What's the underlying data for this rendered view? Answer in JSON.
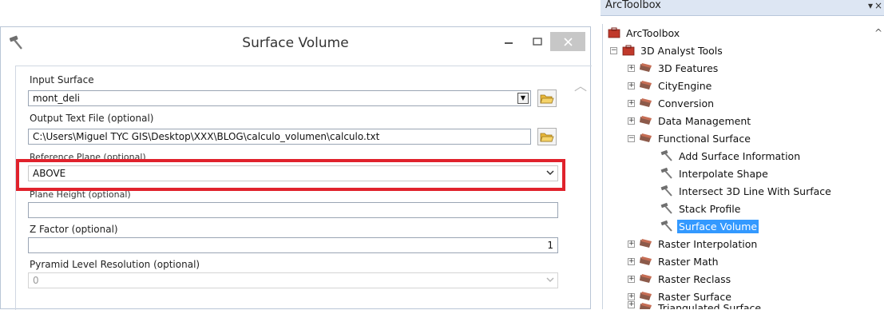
{
  "dialog": {
    "title": "Surface Volume",
    "fields": {
      "input_surface": {
        "label": "Input Surface",
        "value": "mont_deli"
      },
      "output_text": {
        "label": "Output Text File (optional)",
        "value": "C:\\Users\\Miguel TYC GIS\\Desktop\\XXX\\BLOG\\calculo_volumen\\calculo.txt"
      },
      "reference_plane": {
        "label": "Reference Plane (optional)",
        "value": "ABOVE"
      },
      "plane_height": {
        "label": "Plane Height (optional)",
        "value": ""
      },
      "z_factor": {
        "label": "Z Factor (optional)",
        "value": "1"
      },
      "pyramid_level": {
        "label": "Pyramid Level Resolution (optional)",
        "value": "0"
      }
    },
    "highlight_color": "#e0222c"
  },
  "toolbox": {
    "header": "ArcToolbox",
    "root": "ArcToolbox",
    "group": "3D Analyst Tools",
    "items": [
      {
        "label": "3D Features",
        "kind": "toolset",
        "expander": "+"
      },
      {
        "label": "CityEngine",
        "kind": "toolset",
        "expander": "+"
      },
      {
        "label": "Conversion",
        "kind": "toolset",
        "expander": "+"
      },
      {
        "label": "Data Management",
        "kind": "toolset",
        "expander": "+"
      },
      {
        "label": "Functional Surface",
        "kind": "toolset",
        "expander": "−"
      },
      {
        "label": "Add Surface Information",
        "kind": "tool"
      },
      {
        "label": "Interpolate Shape",
        "kind": "tool"
      },
      {
        "label": "Intersect 3D Line With Surface",
        "kind": "tool"
      },
      {
        "label": "Stack Profile",
        "kind": "tool"
      },
      {
        "label": "Surface Volume",
        "kind": "tool",
        "selected": true
      },
      {
        "label": "Raster Interpolation",
        "kind": "toolset",
        "expander": "+"
      },
      {
        "label": "Raster Math",
        "kind": "toolset",
        "expander": "+"
      },
      {
        "label": "Raster Reclass",
        "kind": "toolset",
        "expander": "+"
      },
      {
        "label": "Raster Surface",
        "kind": "toolset",
        "expander": "+"
      },
      {
        "label": "Triangulated Surface",
        "kind": "toolset",
        "expander": "+"
      }
    ],
    "selection_color": "#3399ff"
  }
}
